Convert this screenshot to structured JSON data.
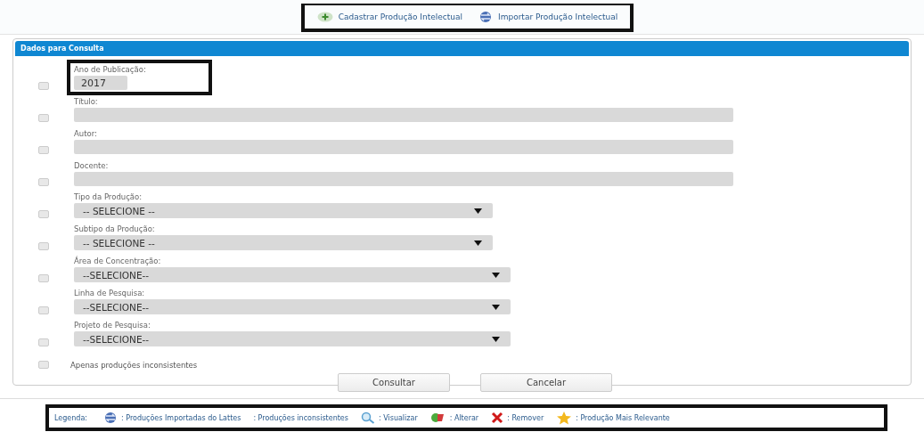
{
  "top_actions": [
    {
      "kind": "add",
      "label": "Cadastrar Produção Intelectual"
    },
    {
      "kind": "import",
      "label": "Importar Produção Intelectual"
    }
  ],
  "panel": {
    "title": "Dados para Consulta",
    "fields": [
      {
        "kind": "year",
        "label": "Ano de Publicação:",
        "value": "2017",
        "checked": false,
        "highlighted": true
      },
      {
        "kind": "text",
        "label": "Título:",
        "checked": false,
        "highlighted": false
      },
      {
        "kind": "text",
        "label": "Autor:",
        "checked": false,
        "highlighted": false
      },
      {
        "kind": "text",
        "label": "Docente:",
        "checked": false,
        "highlighted": false
      },
      {
        "kind": "select",
        "label": "Tipo da Produção:",
        "value": "-- SELECIONE --",
        "checked": false,
        "highlighted": false
      },
      {
        "kind": "select",
        "label": "Subtipo da Produção:",
        "value": "-- SELECIONE --",
        "checked": false,
        "highlighted": false
      },
      {
        "kind": "select",
        "label": "Área de Concentração:",
        "value": "--SELECIONE--",
        "checked": false,
        "highlighted": false
      },
      {
        "kind": "select",
        "label": "Linha de Pesquisa:",
        "value": "--SELECIONE--",
        "checked": false,
        "highlighted": false
      },
      {
        "kind": "select",
        "label": "Projeto de Pesquisa:",
        "value": "--SELECIONE--",
        "checked": false,
        "highlighted": false
      }
    ],
    "option": {
      "label": "Apenas produções inconsistentes",
      "checked": false
    },
    "buttons": [
      "Consultar",
      "Cancelar"
    ]
  },
  "legend": {
    "title": "Legenda:",
    "items": [
      {
        "kind": "import",
        "label": ": Produções Importadas do Lattes"
      },
      {
        "kind": "none",
        "label": ": Produções inconsistentes"
      },
      {
        "kind": "view",
        "label": ": Visualizar"
      },
      {
        "kind": "edit",
        "label": ": Alterar"
      },
      {
        "kind": "remove",
        "label": ": Remover"
      },
      {
        "kind": "star",
        "label": ": Produção Mais Relevante"
      }
    ]
  }
}
